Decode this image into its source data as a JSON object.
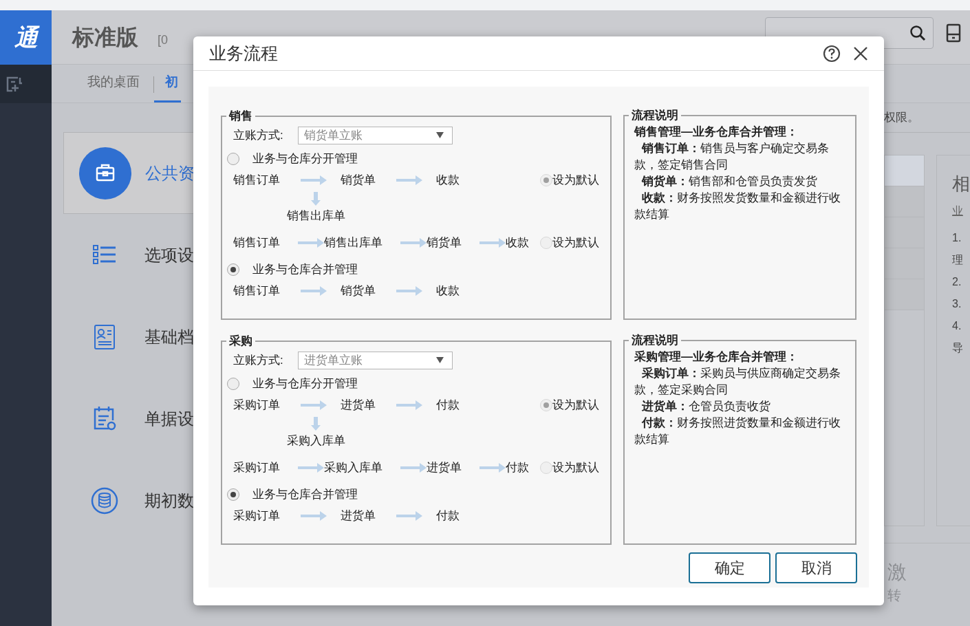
{
  "app": {
    "logo": "通",
    "edition": "标准版",
    "account_prefix": "[0",
    "tabs": [
      {
        "label": "我的桌面",
        "selected": false
      },
      {
        "label": "初",
        "selected": true
      }
    ],
    "notice": "权限。",
    "shortcuts": [
      {
        "label": "公共资",
        "kind": "briefcase",
        "selected": true
      },
      {
        "label": "选项设",
        "kind": "checklist",
        "selected": false
      },
      {
        "label": "基础档",
        "kind": "profile",
        "selected": false
      },
      {
        "label": "单据设",
        "kind": "calendar",
        "selected": false
      },
      {
        "label": "期初数",
        "kind": "database",
        "selected": false
      }
    ],
    "list_rows": [
      {
        "selected": true
      },
      {
        "selected": false
      },
      {
        "selected": false
      },
      {
        "selected": false
      },
      {
        "selected": false
      }
    ],
    "help_panel": {
      "title": "相",
      "link": "业",
      "lines": [
        "1.",
        "理",
        "2.",
        "3.",
        "4.",
        "导"
      ]
    },
    "footer": [
      "激",
      "转"
    ]
  },
  "dialog": {
    "title": "业务流程",
    "sections": [
      {
        "title": "销售",
        "posting_label": "立账方式:",
        "posting_value": "销货单立账",
        "options": [
          {
            "label": "业务与仓库分开管理",
            "selected": false,
            "flows": [
              {
                "steps": [
                  "销售订单",
                  "销货单",
                  "收款"
                ],
                "branch": "销售出库单",
                "default_label": "设为默认",
                "default_selected": true
              },
              {
                "steps": [
                  "销售订单",
                  "销售出库单",
                  "销货单",
                  "收款"
                ],
                "default_label": "设为默认",
                "default_selected": false
              }
            ]
          },
          {
            "label": "业务与仓库合并管理",
            "selected": true,
            "flows": [
              {
                "steps": [
                  "销售订单",
                  "销货单",
                  "收款"
                ]
              }
            ]
          }
        ],
        "description": {
          "title": "流程说明",
          "heading": "销售管理—业务仓库合并管理：",
          "items": [
            "**销售订单：**销售员与客户确定交易条款，签定销售合同",
            "**销货单：**销售部和仓管员负责发货",
            "**收款：**财务按照发货数量和金额进行收款结算"
          ]
        }
      },
      {
        "title": "采购",
        "posting_label": "立账方式:",
        "posting_value": "进货单立账",
        "options": [
          {
            "label": "业务与仓库分开管理",
            "selected": false,
            "flows": [
              {
                "steps": [
                  "采购订单",
                  "进货单",
                  "付款"
                ],
                "branch": "采购入库单",
                "default_label": "设为默认",
                "default_selected": true
              },
              {
                "steps": [
                  "采购订单",
                  "采购入库单",
                  "进货单",
                  "付款"
                ],
                "default_label": "设为默认",
                "default_selected": false
              }
            ]
          },
          {
            "label": "业务与仓库合并管理",
            "selected": true,
            "flows": [
              {
                "steps": [
                  "采购订单",
                  "进货单",
                  "付款"
                ]
              }
            ]
          }
        ],
        "description": {
          "title": "流程说明",
          "heading": "采购管理—业务仓库合并管理：",
          "items": [
            "**采购订单：**采购员与供应商确定交易条款，签定采购合同",
            "**进货单：**仓管员负责收货",
            "**付款：**财务按照进货数量和金额进行收款结算"
          ]
        }
      }
    ],
    "buttons": [
      "确定",
      "取消"
    ]
  }
}
